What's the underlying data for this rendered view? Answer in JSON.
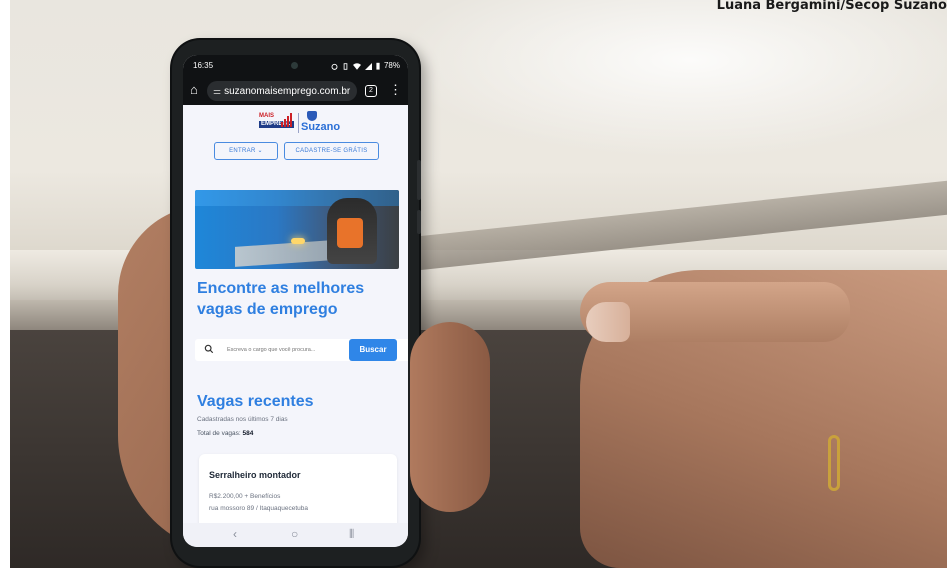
{
  "photo": {
    "credit": "Luana Bergamini/Secop Suzano"
  },
  "status_bar": {
    "time": "16:35",
    "icons": [
      "alarm-icon",
      "vibrate-icon",
      "wifi-icon",
      "signal-icon",
      "battery-icon"
    ],
    "battery": "78%"
  },
  "browser": {
    "url": "suzanomaisemprego.com.br",
    "tab_count": "2"
  },
  "brand": {
    "logo_top": "MAIS",
    "logo_bottom": "EMPREGO",
    "city": "Suzano"
  },
  "nav": {
    "login_label": "ENTRAR",
    "signup_label": "CADASTRE-SE GRÁTIS"
  },
  "hero": {
    "headline_line1": "Encontre as melhores",
    "headline_line2": "vagas de emprego"
  },
  "search": {
    "placeholder": "Escreva o cargo que você procura...",
    "button_label": "Buscar"
  },
  "recent": {
    "title": "Vagas recentes",
    "subtitle": "Cadastradas nos últimos 7 dias",
    "total_label": "Total de vagas:",
    "total_value": "584",
    "jobs": [
      {
        "title": "Serralheiro montador",
        "pay": "R$2.200,00 + Benefícios",
        "address": "rua mossoro 89 / Itaquaquecetuba"
      }
    ]
  },
  "android_nav": {
    "back": "‹",
    "home": "○",
    "recents": "⦀"
  },
  "colors": {
    "accent": "#2f7fe0",
    "button": "#2f86e8",
    "screen_bg": "#f4f5fb",
    "browser_chrome": "#101214"
  }
}
